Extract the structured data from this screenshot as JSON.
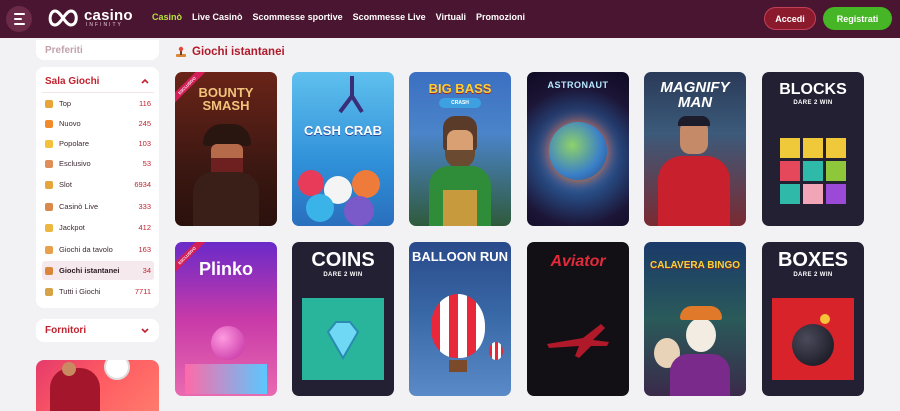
{
  "header": {
    "logo_word": "casino",
    "logo_sub": "INFINITY",
    "nav": [
      "Casinò",
      "Live Casinò",
      "Scommesse sportive",
      "Scommesse Live",
      "Virtuali",
      "Promozioni"
    ],
    "login_label": "Accedi",
    "register_label": "Registrati"
  },
  "sidebar": {
    "favorites_label": "Preferiti",
    "sala_label": "Sala Giochi",
    "categories": [
      {
        "label": "Top",
        "count": "116",
        "icon": "trophy-icon"
      },
      {
        "label": "Nuovo",
        "count": "245",
        "icon": "flame-icon"
      },
      {
        "label": "Popolare",
        "count": "103",
        "icon": "star-icon"
      },
      {
        "label": "Esclusivo",
        "count": "53",
        "icon": "diamond-icon"
      },
      {
        "label": "Slot",
        "count": "6934",
        "icon": "slot-icon"
      },
      {
        "label": "Casinò Live",
        "count": "333",
        "icon": "dealer-icon"
      },
      {
        "label": "Jackpot",
        "count": "412",
        "icon": "jackpot-icon"
      },
      {
        "label": "Giochi da tavolo",
        "count": "163",
        "icon": "cards-icon"
      },
      {
        "label": "Giochi istantanei",
        "count": "34",
        "icon": "joystick-icon",
        "selected": true
      },
      {
        "label": "Tutti i Giochi",
        "count": "7711",
        "icon": "all-games-icon"
      }
    ],
    "providers_label": "Fornitori"
  },
  "main": {
    "section_title": "Giochi istantanei",
    "games": [
      {
        "title": "BOUNTY SMASH",
        "badge": "ESCLUSIVO"
      },
      {
        "title": "CASH CRAB"
      },
      {
        "title": "BIG BASS",
        "subtitle": "CRASH"
      },
      {
        "title": "ASTRONAUT"
      },
      {
        "title": "MAGNIFY MAN"
      },
      {
        "title": "BLOCKS",
        "subtitle": "DARE 2 WIN"
      },
      {
        "title": "Plinko",
        "badge": "ESCLUSIVO"
      },
      {
        "title": "COINS",
        "subtitle": "DARE 2 WIN"
      },
      {
        "title": "BALLOON RUN"
      },
      {
        "title": "Aviator"
      },
      {
        "title": "CALAVERA BINGO"
      },
      {
        "title": "BOXES",
        "subtitle": "DARE 2 WIN"
      }
    ]
  }
}
